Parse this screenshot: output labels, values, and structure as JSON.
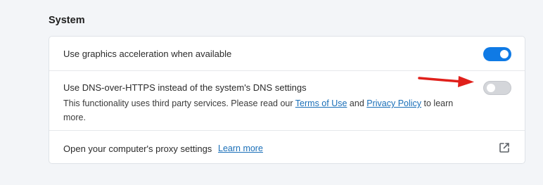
{
  "section": {
    "title": "System"
  },
  "settings": {
    "graphics_acceleration": {
      "label": "Use graphics acceleration when available",
      "enabled": true
    },
    "dns_over_https": {
      "label": "Use DNS-over-HTTPS instead of the system's DNS settings",
      "desc_before": "This functionality uses third party services. Please read our ",
      "terms_link": "Terms of Use",
      "desc_and": " and ",
      "privacy_link": "Privacy Policy",
      "desc_after": " to learn more.",
      "enabled": false
    },
    "proxy": {
      "label": "Open your computer's proxy settings",
      "learn_more": "Learn more",
      "icon": "external-link-icon"
    }
  },
  "annotation": {
    "arrow_color": "#e0201b"
  },
  "colors": {
    "accent": "#0f7ae5",
    "link": "#1a6fb8",
    "toggle_off": "#d4d6da"
  }
}
